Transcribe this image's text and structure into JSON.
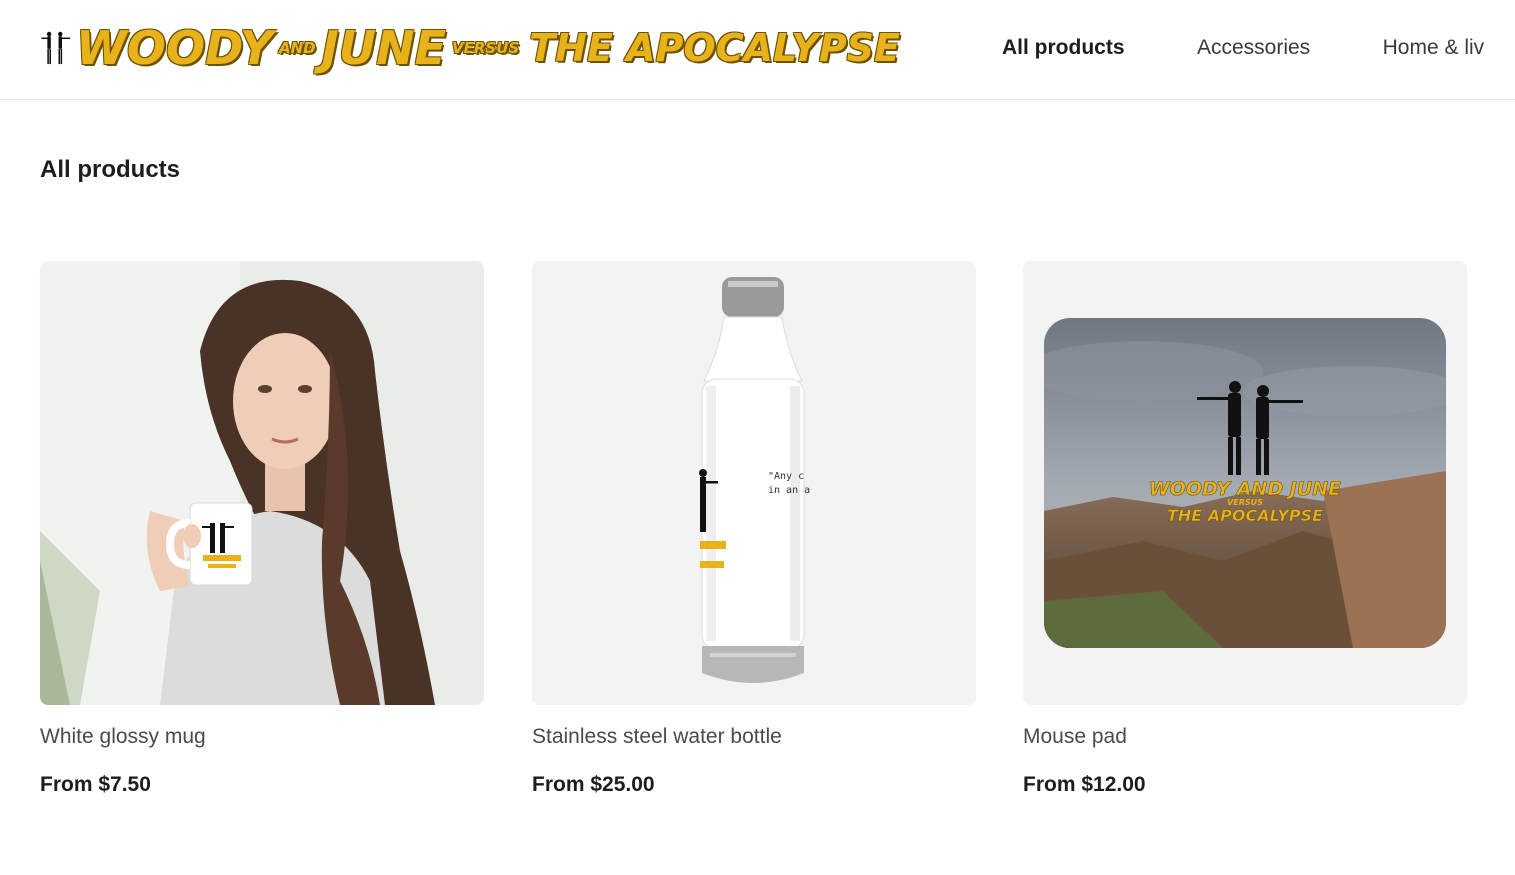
{
  "header": {
    "logo": {
      "word1": "WOODY",
      "word2": "AND",
      "word3": "JUNE",
      "word4": "VERSUS",
      "word5": "THE APOCALYPSE"
    },
    "nav": [
      {
        "label": "All products",
        "active": true
      },
      {
        "label": "Accessories",
        "active": false
      },
      {
        "label": "Home & liv",
        "active": false
      }
    ]
  },
  "page": {
    "title": "All products"
  },
  "products": [
    {
      "name": "White glossy mug",
      "price": "From $7.50",
      "image_icon": "woman-holding-mug-photo"
    },
    {
      "name": "Stainless steel water bottle",
      "price": "From $25.00",
      "image_icon": "water-bottle-photo",
      "print_text_1": "\"Any c",
      "print_text_2": "in an a"
    },
    {
      "name": "Mouse pad",
      "price": "From $12.00",
      "image_icon": "mouse-pad-photo"
    }
  ],
  "colors": {
    "logo_yellow": "#e8b21a",
    "logo_outline": "#6e5200",
    "card_bg": "#f3f3f3"
  }
}
